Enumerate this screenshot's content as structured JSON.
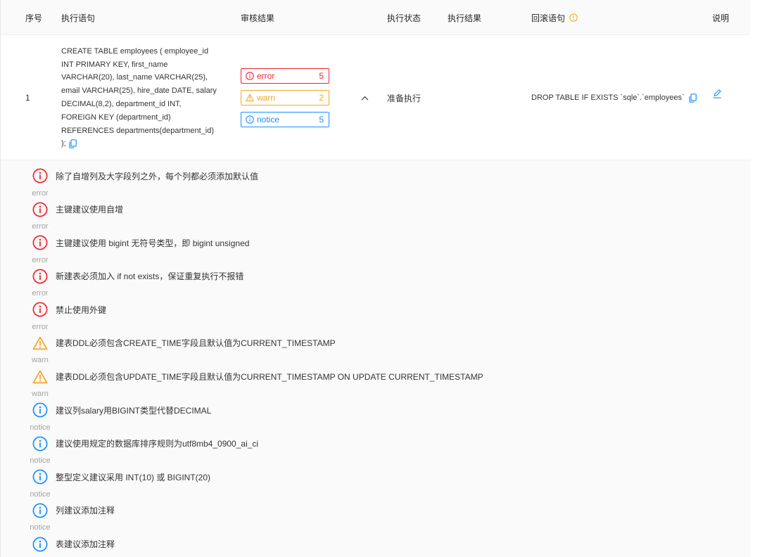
{
  "colors": {
    "error": "#f5222d",
    "warn": "#f5a623",
    "notice": "#1890ff",
    "link": "#1890ff",
    "info": "#faad14"
  },
  "header": {
    "index": "序号",
    "sql": "执行语句",
    "audit_result": "审核结果",
    "exec_status": "执行状态",
    "exec_result": "执行结果",
    "rollback_sql": "回滚语句",
    "rollback_info_icon": "info-circle-icon",
    "description": "说明"
  },
  "row": {
    "index": "1",
    "sql_lines": [
      "CREATE TABLE employees ( employee_id",
      "INT PRIMARY KEY, first_name",
      "VARCHAR(20), last_name VARCHAR(25),",
      "email VARCHAR(25), hire_date DATE, salary",
      "DECIMAL(8,2), department_id INT,",
      "FOREIGN KEY (department_id)",
      "REFERENCES departments(department_id)",
      ");"
    ],
    "sql_copy_icon": "copy-icon",
    "audit_badges": [
      {
        "icon": "error-icon",
        "label": "error",
        "count": 5
      },
      {
        "icon": "warning-icon",
        "label": "warn",
        "count": 2
      },
      {
        "icon": "notice-icon",
        "label": "notice",
        "count": 5
      }
    ],
    "expand_icon": "chevron-up-icon",
    "exec_status": "准备执行",
    "rollback_sql": "DROP TABLE IF EXISTS `sqle`.`employees`",
    "rollback_copy_icon": "copy-icon",
    "edit_icon": "edit-icon"
  },
  "audit_details": [
    {
      "icon": "error-icon",
      "message": "除了自增列及大字段列之外，每个列都必须添加默认值",
      "label": "error"
    },
    {
      "icon": "error-icon",
      "message": "主键建议使用自增",
      "label": "error"
    },
    {
      "icon": "error-icon",
      "message": "主键建议使用 bigint 无符号类型，即 bigint unsigned",
      "label": "error"
    },
    {
      "icon": "error-icon",
      "message": "新建表必须加入 if not exists，保证重复执行不报错",
      "label": "error"
    },
    {
      "icon": "error-icon",
      "message": "禁止使用外键",
      "label": "error"
    },
    {
      "icon": "warning-icon",
      "message": "建表DDL必须包含CREATE_TIME字段且默认值为CURRENT_TIMESTAMP",
      "label": "warn"
    },
    {
      "icon": "warning-icon",
      "message": "建表DDL必须包含UPDATE_TIME字段且默认值为CURRENT_TIMESTAMP ON UPDATE CURRENT_TIMESTAMP",
      "label": "warn"
    },
    {
      "icon": "notice-icon",
      "message": "建议列salary用BIGINT类型代替DECIMAL",
      "label": "notice"
    },
    {
      "icon": "notice-icon",
      "message": "建议使用规定的数据库排序规则为utf8mb4_0900_ai_ci",
      "label": "notice"
    },
    {
      "icon": "notice-icon",
      "message": "整型定义建议采用 INT(10) 或 BIGINT(20)",
      "label": "notice"
    },
    {
      "icon": "notice-icon",
      "message": "列建议添加注释",
      "label": "notice"
    },
    {
      "icon": "notice-icon",
      "message": "表建议添加注释"
    }
  ]
}
